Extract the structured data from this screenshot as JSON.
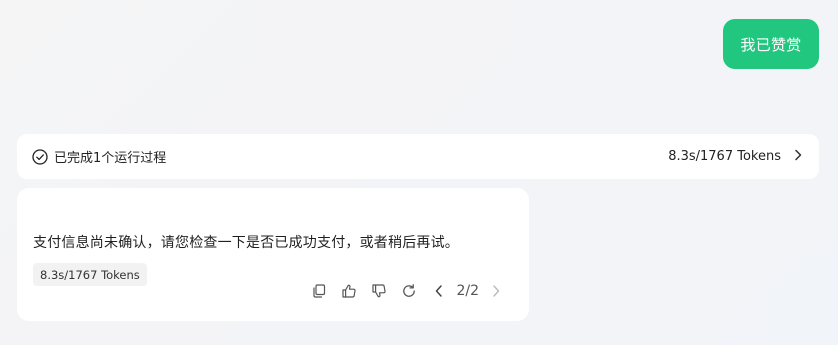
{
  "user_message": {
    "text": "我已赞赏",
    "bg_color": "#22c77f"
  },
  "process": {
    "status_label": "已完成1个运行过程",
    "status_icon": "check-circle-icon",
    "stats": "8.3s/1767 Tokens",
    "expand_icon": "chevron-right-icon"
  },
  "answer": {
    "text": "支付信息尚未确认，请您检查一下是否已成功支付，或者稍后再试。",
    "token_badge": "8.3s/1767 Tokens",
    "actions": {
      "copy_icon": "copy-icon",
      "like_icon": "thumbs-up-icon",
      "dislike_icon": "thumbs-down-icon",
      "regenerate_icon": "refresh-icon",
      "prev_icon": "chevron-left-icon",
      "next_icon": "chevron-right-icon",
      "pager": "2/2"
    }
  }
}
